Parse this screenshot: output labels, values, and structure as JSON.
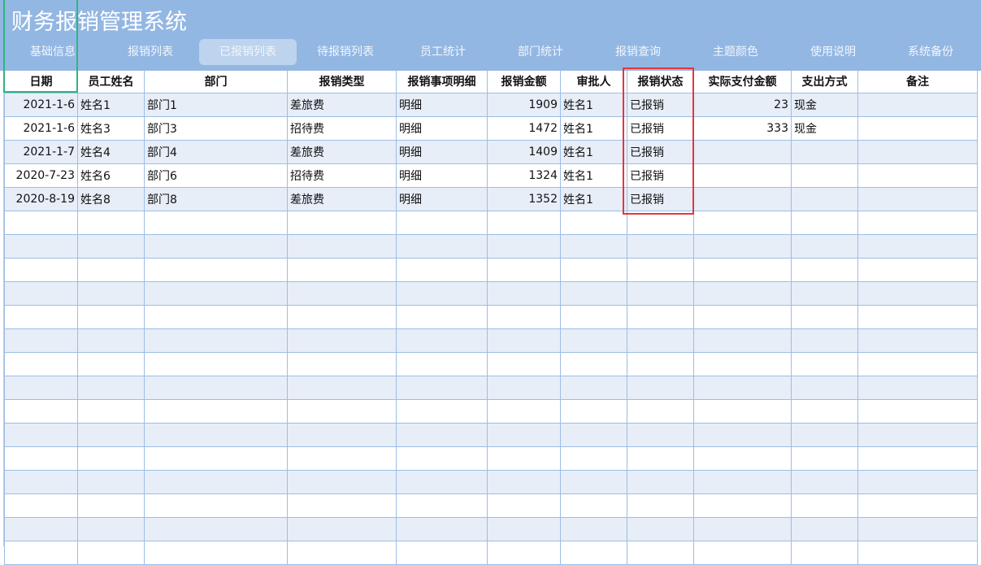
{
  "app_title": "财务报销管理系统",
  "nav": [
    {
      "label": "基础信息"
    },
    {
      "label": "报销列表"
    },
    {
      "label": "已报销列表",
      "active": true
    },
    {
      "label": "待报销列表"
    },
    {
      "label": "员工统计"
    },
    {
      "label": "部门统计"
    },
    {
      "label": "报销查询"
    },
    {
      "label": "主题颜色"
    },
    {
      "label": "使用说明"
    },
    {
      "label": "系统备份"
    }
  ],
  "columns": [
    "日期",
    "员工姓名",
    "部门",
    "报销类型",
    "报销事项明细",
    "报销金额",
    "审批人",
    "报销状态",
    "实际支付金额",
    "支出方式",
    "备注"
  ],
  "rows": [
    [
      "2021-1-6",
      "姓名1",
      "部门1",
      "差旅费",
      "明细",
      "1909",
      "姓名1",
      "已报销",
      "23",
      "现金",
      ""
    ],
    [
      "2021-1-6",
      "姓名3",
      "部门3",
      "招待费",
      "明细",
      "1472",
      "姓名1",
      "已报销",
      "333",
      "现金",
      ""
    ],
    [
      "2021-1-7",
      "姓名4",
      "部门4",
      "差旅费",
      "明细",
      "1409",
      "姓名1",
      "已报销",
      "",
      "",
      ""
    ],
    [
      "2020-7-23",
      "姓名6",
      "部门6",
      "招待费",
      "明细",
      "1324",
      "姓名1",
      "已报销",
      "",
      "",
      ""
    ],
    [
      "2020-8-19",
      "姓名8",
      "部门8",
      "差旅费",
      "明细",
      "1352",
      "姓名1",
      "已报销",
      "",
      "",
      ""
    ]
  ],
  "colors": {
    "banner": "#93b7e3",
    "grid_line": "#9dbde6",
    "alt_row": "#e7eef8",
    "highlight": "#e8343a",
    "selection": "#2cb67d"
  }
}
